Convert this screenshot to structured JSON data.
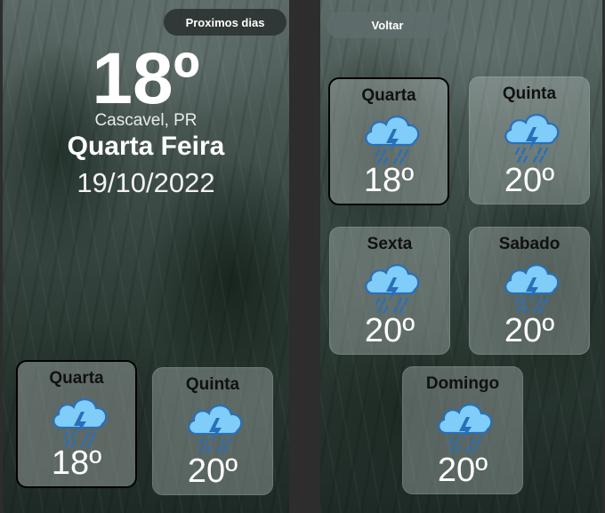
{
  "main": {
    "next_days_label": "Proximos dias",
    "temperature": "18º",
    "city": "Cascavel, PR",
    "weekday": "Quarta Feira",
    "date": "19/10/2022",
    "cards": [
      {
        "day": "Quarta",
        "temp": "18º",
        "icon": "rain-thunder-icon"
      },
      {
        "day": "Quinta",
        "temp": "20º",
        "icon": "rain-thunder-icon"
      }
    ]
  },
  "forecast": {
    "back_label": "Voltar",
    "cards": [
      {
        "day": "Quarta",
        "temp": "18º",
        "icon": "rain-thunder-icon"
      },
      {
        "day": "Quinta",
        "temp": "20º",
        "icon": "rain-thunder-icon"
      },
      {
        "day": "Sexta",
        "temp": "20º",
        "icon": "rain-thunder-icon"
      },
      {
        "day": "Sabado",
        "temp": "20º",
        "icon": "rain-thunder-icon"
      },
      {
        "day": "Domingo",
        "temp": "20º",
        "icon": "rain-thunder-icon"
      }
    ]
  },
  "colors": {
    "cloud": "#6ec6f7",
    "bolt": "#2a6fb8",
    "rain": "#2a6fb8"
  }
}
